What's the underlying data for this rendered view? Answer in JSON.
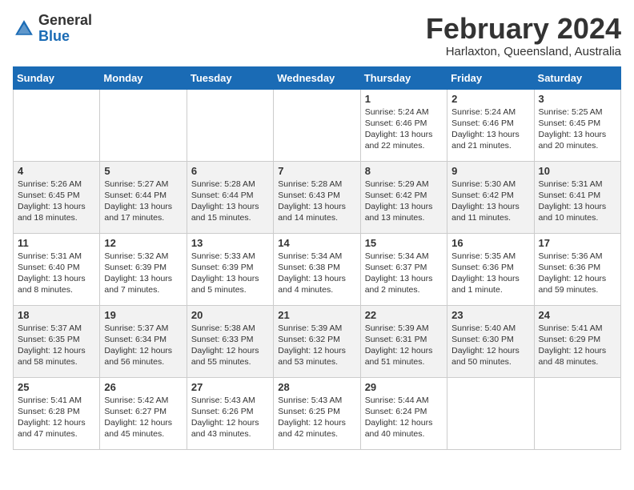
{
  "header": {
    "logo_general": "General",
    "logo_blue": "Blue",
    "title": "February 2024",
    "subtitle": "Harlaxton, Queensland, Australia"
  },
  "days_of_week": [
    "Sunday",
    "Monday",
    "Tuesday",
    "Wednesday",
    "Thursday",
    "Friday",
    "Saturday"
  ],
  "weeks": [
    [
      {
        "day": "",
        "info": ""
      },
      {
        "day": "",
        "info": ""
      },
      {
        "day": "",
        "info": ""
      },
      {
        "day": "",
        "info": ""
      },
      {
        "day": "1",
        "info": "Sunrise: 5:24 AM\nSunset: 6:46 PM\nDaylight: 13 hours\nand 22 minutes."
      },
      {
        "day": "2",
        "info": "Sunrise: 5:24 AM\nSunset: 6:46 PM\nDaylight: 13 hours\nand 21 minutes."
      },
      {
        "day": "3",
        "info": "Sunrise: 5:25 AM\nSunset: 6:45 PM\nDaylight: 13 hours\nand 20 minutes."
      }
    ],
    [
      {
        "day": "4",
        "info": "Sunrise: 5:26 AM\nSunset: 6:45 PM\nDaylight: 13 hours\nand 18 minutes."
      },
      {
        "day": "5",
        "info": "Sunrise: 5:27 AM\nSunset: 6:44 PM\nDaylight: 13 hours\nand 17 minutes."
      },
      {
        "day": "6",
        "info": "Sunrise: 5:28 AM\nSunset: 6:44 PM\nDaylight: 13 hours\nand 15 minutes."
      },
      {
        "day": "7",
        "info": "Sunrise: 5:28 AM\nSunset: 6:43 PM\nDaylight: 13 hours\nand 14 minutes."
      },
      {
        "day": "8",
        "info": "Sunrise: 5:29 AM\nSunset: 6:42 PM\nDaylight: 13 hours\nand 13 minutes."
      },
      {
        "day": "9",
        "info": "Sunrise: 5:30 AM\nSunset: 6:42 PM\nDaylight: 13 hours\nand 11 minutes."
      },
      {
        "day": "10",
        "info": "Sunrise: 5:31 AM\nSunset: 6:41 PM\nDaylight: 13 hours\nand 10 minutes."
      }
    ],
    [
      {
        "day": "11",
        "info": "Sunrise: 5:31 AM\nSunset: 6:40 PM\nDaylight: 13 hours\nand 8 minutes."
      },
      {
        "day": "12",
        "info": "Sunrise: 5:32 AM\nSunset: 6:39 PM\nDaylight: 13 hours\nand 7 minutes."
      },
      {
        "day": "13",
        "info": "Sunrise: 5:33 AM\nSunset: 6:39 PM\nDaylight: 13 hours\nand 5 minutes."
      },
      {
        "day": "14",
        "info": "Sunrise: 5:34 AM\nSunset: 6:38 PM\nDaylight: 13 hours\nand 4 minutes."
      },
      {
        "day": "15",
        "info": "Sunrise: 5:34 AM\nSunset: 6:37 PM\nDaylight: 13 hours\nand 2 minutes."
      },
      {
        "day": "16",
        "info": "Sunrise: 5:35 AM\nSunset: 6:36 PM\nDaylight: 13 hours\nand 1 minute."
      },
      {
        "day": "17",
        "info": "Sunrise: 5:36 AM\nSunset: 6:36 PM\nDaylight: 12 hours\nand 59 minutes."
      }
    ],
    [
      {
        "day": "18",
        "info": "Sunrise: 5:37 AM\nSunset: 6:35 PM\nDaylight: 12 hours\nand 58 minutes."
      },
      {
        "day": "19",
        "info": "Sunrise: 5:37 AM\nSunset: 6:34 PM\nDaylight: 12 hours\nand 56 minutes."
      },
      {
        "day": "20",
        "info": "Sunrise: 5:38 AM\nSunset: 6:33 PM\nDaylight: 12 hours\nand 55 minutes."
      },
      {
        "day": "21",
        "info": "Sunrise: 5:39 AM\nSunset: 6:32 PM\nDaylight: 12 hours\nand 53 minutes."
      },
      {
        "day": "22",
        "info": "Sunrise: 5:39 AM\nSunset: 6:31 PM\nDaylight: 12 hours\nand 51 minutes."
      },
      {
        "day": "23",
        "info": "Sunrise: 5:40 AM\nSunset: 6:30 PM\nDaylight: 12 hours\nand 50 minutes."
      },
      {
        "day": "24",
        "info": "Sunrise: 5:41 AM\nSunset: 6:29 PM\nDaylight: 12 hours\nand 48 minutes."
      }
    ],
    [
      {
        "day": "25",
        "info": "Sunrise: 5:41 AM\nSunset: 6:28 PM\nDaylight: 12 hours\nand 47 minutes."
      },
      {
        "day": "26",
        "info": "Sunrise: 5:42 AM\nSunset: 6:27 PM\nDaylight: 12 hours\nand 45 minutes."
      },
      {
        "day": "27",
        "info": "Sunrise: 5:43 AM\nSunset: 6:26 PM\nDaylight: 12 hours\nand 43 minutes."
      },
      {
        "day": "28",
        "info": "Sunrise: 5:43 AM\nSunset: 6:25 PM\nDaylight: 12 hours\nand 42 minutes."
      },
      {
        "day": "29",
        "info": "Sunrise: 5:44 AM\nSunset: 6:24 PM\nDaylight: 12 hours\nand 40 minutes."
      },
      {
        "day": "",
        "info": ""
      },
      {
        "day": "",
        "info": ""
      }
    ]
  ]
}
